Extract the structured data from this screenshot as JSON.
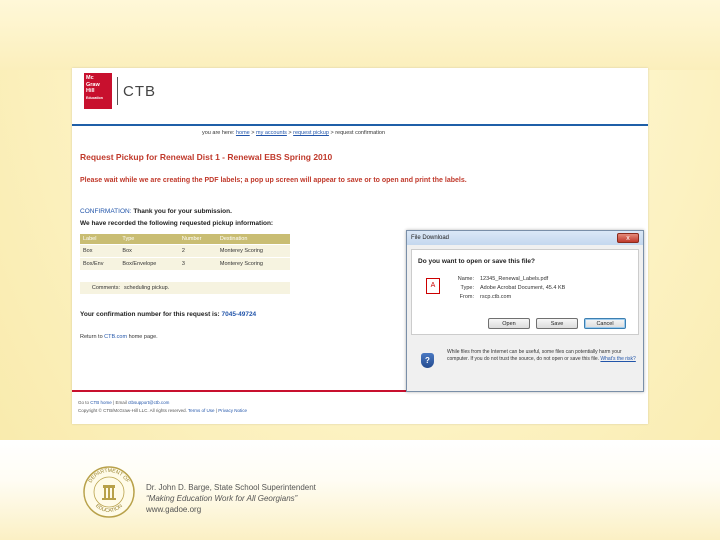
{
  "logo": {
    "brand_lines": [
      "Mc",
      "Graw",
      "Hill",
      "Education"
    ],
    "ctb": "CTB"
  },
  "breadcrumb": {
    "prefix": "you are here:",
    "items": [
      "home",
      "my accounts",
      "request pickup"
    ],
    "current": "request confirmation"
  },
  "page": {
    "title": "Request Pickup for Renewal Dist 1 - Renewal EBS Spring 2010",
    "wait_message": "Please wait while we are creating the PDF labels; a pop up screen will appear to save or to open and print the labels.",
    "confirmation_label": "CONFIRMATION:",
    "confirmation_text": "Thank you for your submission.",
    "recorded_text": "We have recorded the following requested pickup information:"
  },
  "pickup_table": {
    "headers": [
      "Label",
      "Type",
      "Number",
      "Destination"
    ],
    "rows": [
      [
        "Box",
        "Box",
        "2",
        "Monterey Scoring"
      ],
      [
        "Box/Env",
        "Box/Envelope",
        "3",
        "Monterey Scoring"
      ]
    ],
    "comments_label": "Comments:",
    "comments_value": "scheduling pickup."
  },
  "confirmation_number": {
    "label": "Your confirmation number for this request is:",
    "value": "7045-49724"
  },
  "return_link": {
    "prefix": "Return to",
    "link": "CTB.com",
    "suffix": "home page."
  },
  "footer": {
    "line1_prefix": "Go to",
    "line1_link1": "CTB home",
    "line1_mid": "| Email",
    "line1_link2": "ctbsupport@ctb.com",
    "line2_prefix": "Copyright © CTB/McGraw-Hill LLC. All rights reserved.",
    "line2_links": [
      "Terms of Use",
      "Privacy Notice"
    ]
  },
  "dialog": {
    "title": "File Download",
    "close_glyph": "x",
    "question": "Do you want to open or save this file?",
    "name_label": "Name:",
    "name_value": "12345_Renewal_Labels.pdf",
    "type_label": "Type:",
    "type_value": "Adobe Acrobat Document, 45.4 KB",
    "from_label": "From:",
    "from_value": "rscp.ctb.com",
    "buttons": {
      "open": "Open",
      "save": "Save",
      "cancel": "Cancel"
    },
    "warning": "While files from the Internet can be useful, some files can potentially harm your computer. If you do not trust the source, do not open or save this file.",
    "risk_link": "What's the risk?",
    "pdf_glyph": "A",
    "shield_glyph": "?"
  },
  "gadoe": {
    "line1": "Dr. John D. Barge, State School Superintendent",
    "line2": "“Making Education Work for All Georgians”",
    "line3": "www.gadoe.org",
    "seal_top": "DEPARTMENT OF",
    "seal_bottom": "EDUCATION"
  },
  "colors": {
    "ctb_red": "#c8102e",
    "link_blue": "#2255aa",
    "title_red": "#c0392b",
    "table_header": "#c9bd73"
  }
}
